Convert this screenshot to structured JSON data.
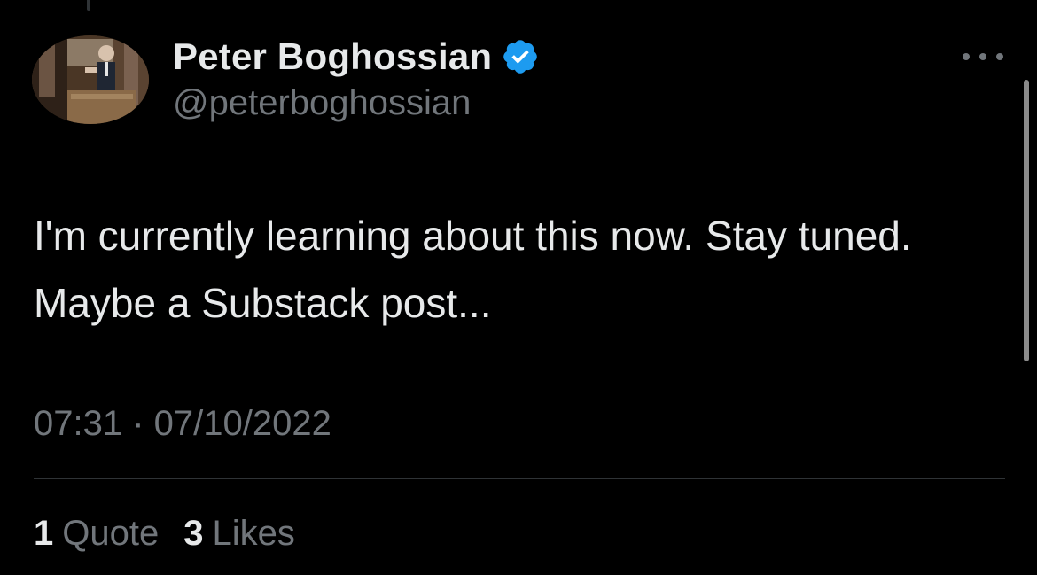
{
  "author": {
    "display_name": "Peter Boghossian",
    "handle": "@peterboghossian",
    "verified": true
  },
  "tweet": {
    "text": "I'm currently learning about this now. Stay tuned. Maybe a Substack post...",
    "timestamp": "07:31 · 07/10/2022"
  },
  "stats": {
    "quotes_count": "1",
    "quotes_label": "Quote",
    "likes_count": "3",
    "likes_label": "Likes"
  },
  "icons": {
    "verified": "verified-badge-icon",
    "more": "more-options-icon"
  },
  "colors": {
    "background": "#000000",
    "primary_text": "#e7e9ea",
    "secondary_text": "#71767b",
    "verified_blue": "#1d9bf0",
    "divider": "#2f3336"
  }
}
